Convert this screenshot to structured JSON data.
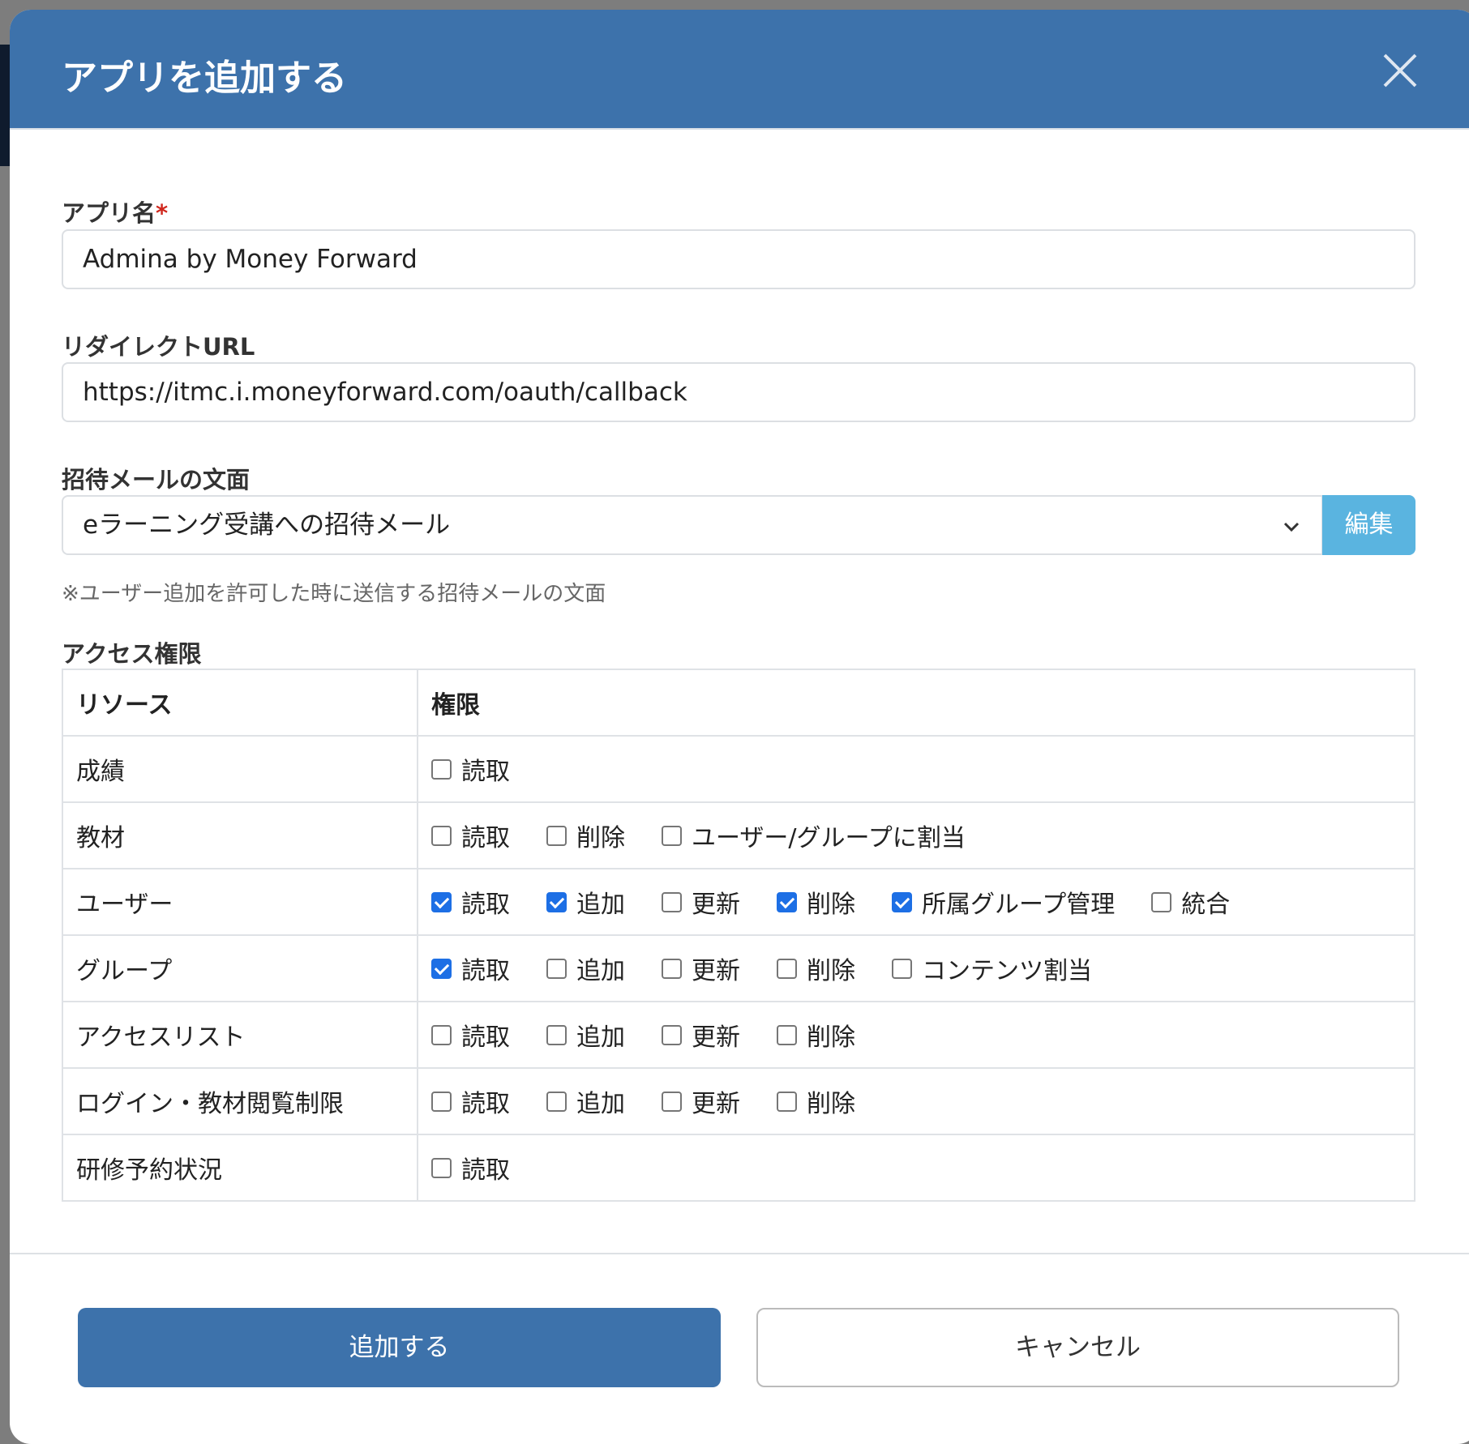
{
  "modal": {
    "title": "アプリを追加する"
  },
  "form": {
    "app_name_label": "アプリ名",
    "required_mark": "*",
    "app_name_value": "Admina by Money Forward",
    "redirect_label": "リダイレクトURL",
    "redirect_value": "https://itmc.i.moneyforward.com/oauth/callback",
    "invite_label": "招待メールの文面",
    "invite_value": "eラーニング受講への招待メール",
    "edit_label": "編集",
    "invite_hint": "※ユーザー追加を許可した時に送信する招待メールの文面",
    "access_label": "アクセス権限"
  },
  "table": {
    "headers": [
      "リソース",
      "権限"
    ],
    "rows": [
      {
        "resource": "成績",
        "perms": [
          {
            "label": "読取",
            "checked": false
          }
        ]
      },
      {
        "resource": "教材",
        "perms": [
          {
            "label": "読取",
            "checked": false
          },
          {
            "label": "削除",
            "checked": false
          },
          {
            "label": "ユーザー/グループに割当",
            "checked": false
          }
        ]
      },
      {
        "resource": "ユーザー",
        "perms": [
          {
            "label": "読取",
            "checked": true
          },
          {
            "label": "追加",
            "checked": true
          },
          {
            "label": "更新",
            "checked": false
          },
          {
            "label": "削除",
            "checked": true
          },
          {
            "label": "所属グループ管理",
            "checked": true
          },
          {
            "label": "統合",
            "checked": false
          }
        ]
      },
      {
        "resource": "グループ",
        "perms": [
          {
            "label": "読取",
            "checked": true
          },
          {
            "label": "追加",
            "checked": false
          },
          {
            "label": "更新",
            "checked": false
          },
          {
            "label": "削除",
            "checked": false
          },
          {
            "label": "コンテンツ割当",
            "checked": false
          }
        ]
      },
      {
        "resource": "アクセスリスト",
        "perms": [
          {
            "label": "読取",
            "checked": false
          },
          {
            "label": "追加",
            "checked": false
          },
          {
            "label": "更新",
            "checked": false
          },
          {
            "label": "削除",
            "checked": false
          }
        ]
      },
      {
        "resource": "ログイン・教材閲覧制限",
        "perms": [
          {
            "label": "読取",
            "checked": false
          },
          {
            "label": "追加",
            "checked": false
          },
          {
            "label": "更新",
            "checked": false
          },
          {
            "label": "削除",
            "checked": false
          }
        ]
      },
      {
        "resource": "研修予約状況",
        "perms": [
          {
            "label": "読取",
            "checked": false
          }
        ]
      }
    ]
  },
  "footer": {
    "submit_label": "追加する",
    "cancel_label": "キャンセル"
  }
}
